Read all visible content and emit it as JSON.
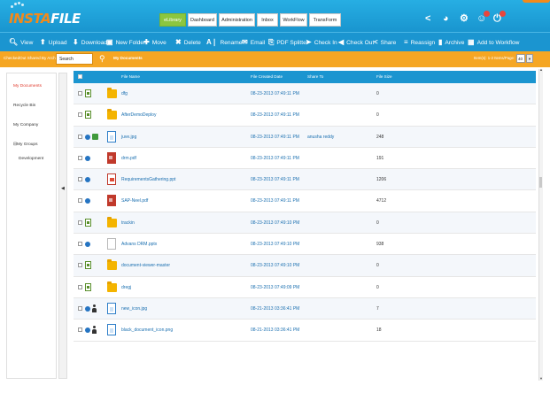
{
  "app": {
    "logo_insta": "INSTA",
    "logo_file": "FILE"
  },
  "nav_tabs": [
    {
      "label": "eLibrary",
      "active": true
    },
    {
      "label": "Dashboard",
      "active": false
    },
    {
      "label": "Administration",
      "active": false
    },
    {
      "label": "Inbox",
      "active": false
    },
    {
      "label": "WorkFlow",
      "active": false
    },
    {
      "label": "TransForm",
      "active": false
    }
  ],
  "header_icons": {
    "share": "share-icon",
    "help": "help-icon",
    "settings": "settings-icon",
    "user": "user-icon",
    "power": "power-icon"
  },
  "toolbar": [
    {
      "label": "View",
      "icon": "search-icon"
    },
    {
      "label": "Upload",
      "icon": "upload-icon"
    },
    {
      "label": "Download",
      "icon": "download-icon"
    },
    {
      "label": "New Folder",
      "icon": "new-folder-icon"
    },
    {
      "label": "Move",
      "icon": "move-icon"
    },
    {
      "label": "Delete",
      "icon": "delete-icon"
    },
    {
      "label": "Rename",
      "icon": "rename-icon"
    },
    {
      "label": "Email",
      "icon": "email-icon"
    },
    {
      "label": "PDF Splitter",
      "icon": "pdf-splitter-icon"
    },
    {
      "label": "Check In",
      "icon": "check-in-icon"
    },
    {
      "label": "Check Out",
      "icon": "check-out-icon"
    },
    {
      "label": "Share",
      "icon": "share-icon"
    },
    {
      "label": "Reassign",
      "icon": "reassign-icon"
    },
    {
      "label": "Archive",
      "icon": "archive-icon"
    },
    {
      "label": "Add to Workflow",
      "icon": "workflow-icon"
    }
  ],
  "searchbar": {
    "filters_text": "CheckedOut  Shared By  Archive",
    "search_value": "Search",
    "location": "My Documents",
    "items_text": "Item(s): 1-2  Items/Page:",
    "items_per_page": "40"
  },
  "sidebar": [
    {
      "label": "My Documents",
      "active": true
    },
    {
      "label": "Recycle Bin",
      "active": false
    },
    {
      "label": "My Company",
      "active": false
    },
    {
      "label": "⊟My Groups",
      "active": false
    },
    {
      "label": "Development",
      "active": false
    }
  ],
  "columns": {
    "name": "File Name",
    "date": "File Created Date",
    "share": "Share To",
    "size": "File Size"
  },
  "rows": [
    {
      "name": "dfg",
      "date": "08-23-2013 07:49:11 PM",
      "share": "",
      "size": "0",
      "type": "folder",
      "icons": [
        "clip"
      ]
    },
    {
      "name": "AfterDemoDeploy",
      "date": "08-23-2013 07:49:11 PM",
      "share": "",
      "size": "0",
      "type": "folder",
      "icons": [
        "clip"
      ]
    },
    {
      "name": "juve.jpg",
      "date": "08-23-2013 07:49:11 PM",
      "share": "anusha reddy",
      "size": "248",
      "type": "doc",
      "icons": [
        "info",
        "share"
      ]
    },
    {
      "name": "drm.pdf",
      "date": "08-23-2013 07:49:11 PM",
      "share": "",
      "size": "191",
      "type": "pdf",
      "icons": [
        "info"
      ]
    },
    {
      "name": "RequirementsGathering.ppt",
      "date": "08-23-2013 07:49:11 PM",
      "share": "",
      "size": "1206",
      "type": "ppt",
      "icons": [
        "info"
      ]
    },
    {
      "name": "SAP-Neel.pdf",
      "date": "08-23-2013 07:49:11 PM",
      "share": "",
      "size": "4712",
      "type": "pdf",
      "icons": [
        "info"
      ]
    },
    {
      "name": "trackin",
      "date": "08-23-2013 07:49:10 PM",
      "share": "",
      "size": "0",
      "type": "folder",
      "icons": [
        "clip"
      ]
    },
    {
      "name": "Advans DRM.pptx",
      "date": "08-23-2013 07:49:10 PM",
      "share": "",
      "size": "938",
      "type": "blank",
      "icons": [
        "info"
      ]
    },
    {
      "name": "document-viewer-master",
      "date": "08-23-2013 07:49:10 PM",
      "share": "",
      "size": "0",
      "type": "folder",
      "icons": [
        "clip"
      ]
    },
    {
      "name": "dregj",
      "date": "08-23-2013 07:49:09 PM",
      "share": "",
      "size": "0",
      "type": "folder",
      "icons": [
        "clip"
      ]
    },
    {
      "name": "new_icon.jpg",
      "date": "08-21-2013 03:36:41 PM",
      "share": "",
      "size": "7",
      "type": "doc",
      "icons": [
        "info",
        "person"
      ]
    },
    {
      "name": "black_document_icon.png",
      "date": "08-21-2013 03:36:41 PM",
      "share": "",
      "size": "18",
      "type": "doc",
      "icons": [
        "info",
        "person"
      ]
    }
  ]
}
